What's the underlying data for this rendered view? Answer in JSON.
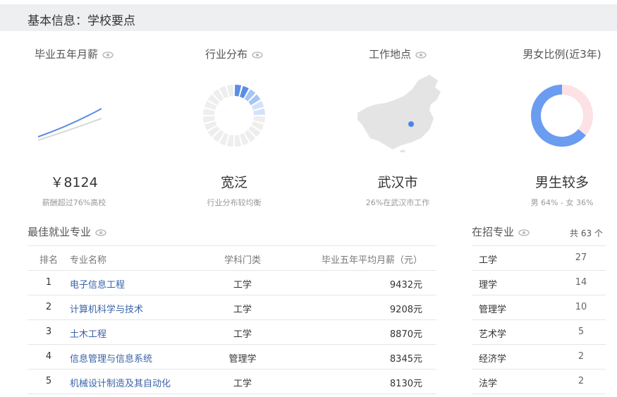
{
  "header": {
    "title": "基本信息：学校要点"
  },
  "cards": [
    {
      "label": "毕业五年月薪",
      "value": "￥8124",
      "sub": "薪酬超过76%高校"
    },
    {
      "label": "行业分布",
      "value": "宽泛",
      "sub": "行业分布较均衡"
    },
    {
      "label": "工作地点",
      "value": "武汉市",
      "sub": "26%在武汉市工作"
    },
    {
      "label": "男女比例(近3年)",
      "value": "男生较多",
      "sub": "男 64% - 女 36%"
    }
  ],
  "gender": {
    "male": 64,
    "female": 36,
    "male_color": "#6a9cf0",
    "female_color": "#fce2e5"
  },
  "colors": {
    "accent": "#5b8de6",
    "light_accent": "#a8c4f5"
  },
  "best": {
    "title": "最佳就业专业",
    "headers": {
      "rank": "排名",
      "name": "专业名称",
      "category": "学科门类",
      "salary": "毕业五年平均月薪（元）"
    },
    "rows": [
      {
        "rank": "1",
        "name": "电子信息工程",
        "category": "工学",
        "salary": "9432元"
      },
      {
        "rank": "2",
        "name": "计算机科学与技术",
        "category": "工学",
        "salary": "9208元"
      },
      {
        "rank": "3",
        "name": "土木工程",
        "category": "工学",
        "salary": "8870元"
      },
      {
        "rank": "4",
        "name": "信息管理与信息系统",
        "category": "管理学",
        "salary": "8345元"
      },
      {
        "rank": "5",
        "name": "机械设计制造及其自动化",
        "category": "工学",
        "salary": "8130元"
      }
    ]
  },
  "enroll": {
    "title": "在招专业",
    "total": "共 63 个",
    "rows": [
      {
        "name": "工学",
        "count": "27"
      },
      {
        "name": "理学",
        "count": "14"
      },
      {
        "name": "管理学",
        "count": "10"
      },
      {
        "name": "艺术学",
        "count": "5"
      },
      {
        "name": "经济学",
        "count": "2"
      },
      {
        "name": "法学",
        "count": "2"
      }
    ]
  }
}
